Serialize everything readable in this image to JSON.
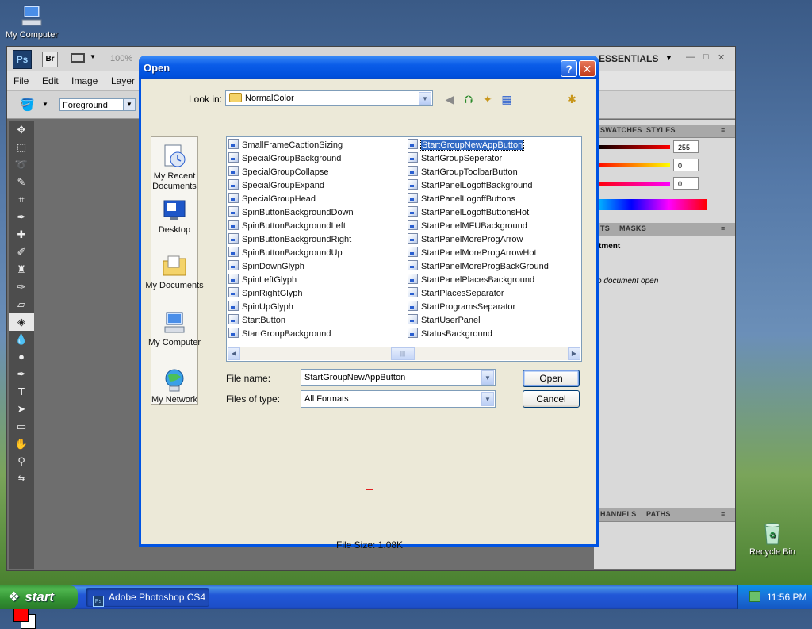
{
  "desktop": {
    "my_computer": "My Computer",
    "recycle_bin": "Recycle Bin"
  },
  "photoshop": {
    "logo": "Ps",
    "bridge": "Br",
    "zoom": "100%",
    "workspace": "ESSENTIALS",
    "menu": [
      "File",
      "Edit",
      "Image",
      "Layer"
    ],
    "options_fill": "Foreground",
    "panels": {
      "tab_swatches": "SWATCHES",
      "tab_styles": "STYLES",
      "rgb": [
        "255",
        "0",
        "0"
      ],
      "tab_adjust": "TS",
      "tab_masks": "MASKS",
      "adj_title": "tment",
      "adj_msg": "o document open",
      "tab_channels": "HANNELS",
      "tab_paths": "PATHS"
    }
  },
  "dialog": {
    "title": "Open",
    "help": "?",
    "close": "✕",
    "look_in_label": "Look in:",
    "look_in_value": "NormalColor",
    "places": [
      "My Recent Documents",
      "Desktop",
      "My Documents",
      "My Computer",
      "My Network"
    ],
    "files_col1": [
      "SmallFrameCaptionSizing",
      "SpecialGroupBackground",
      "SpecialGroupCollapse",
      "SpecialGroupExpand",
      "SpecialGroupHead",
      "SpinButtonBackgroundDown",
      "SpinButtonBackgroundLeft",
      "SpinButtonBackgroundRight",
      "SpinButtonBackgroundUp",
      "SpinDownGlyph",
      "SpinLeftGlyph",
      "SpinRightGlyph",
      "SpinUpGlyph",
      "StartButton",
      "StartGroupBackground"
    ],
    "files_col2": [
      "StartGroupNewAppButton",
      "StartGroupSeperator",
      "StartGroupToolbarButton",
      "StartPanelLogoffBackground",
      "StartPanelLogoffButtons",
      "StartPanelLogoffButtonsHot",
      "StartPanelMFUBackground",
      "StartPanelMoreProgArrow",
      "StartPanelMoreProgArrowHot",
      "StartPanelMoreProgBackGround",
      "StartPanelPlacesBackground",
      "StartPlacesSeparator",
      "StartProgramsSeparator",
      "StartUserPanel",
      "StatusBackground"
    ],
    "file_name_label": "File name:",
    "file_name_value": "StartGroupNewAppButton",
    "file_type_label": "Files of type:",
    "file_type_value": "All Formats",
    "open_label": "Open",
    "cancel_label": "Cancel",
    "file_size": "File Size: 1.08K"
  },
  "taskbar": {
    "start": "start",
    "task": "Adobe Photoshop CS4",
    "clock": "11:56 PM"
  }
}
